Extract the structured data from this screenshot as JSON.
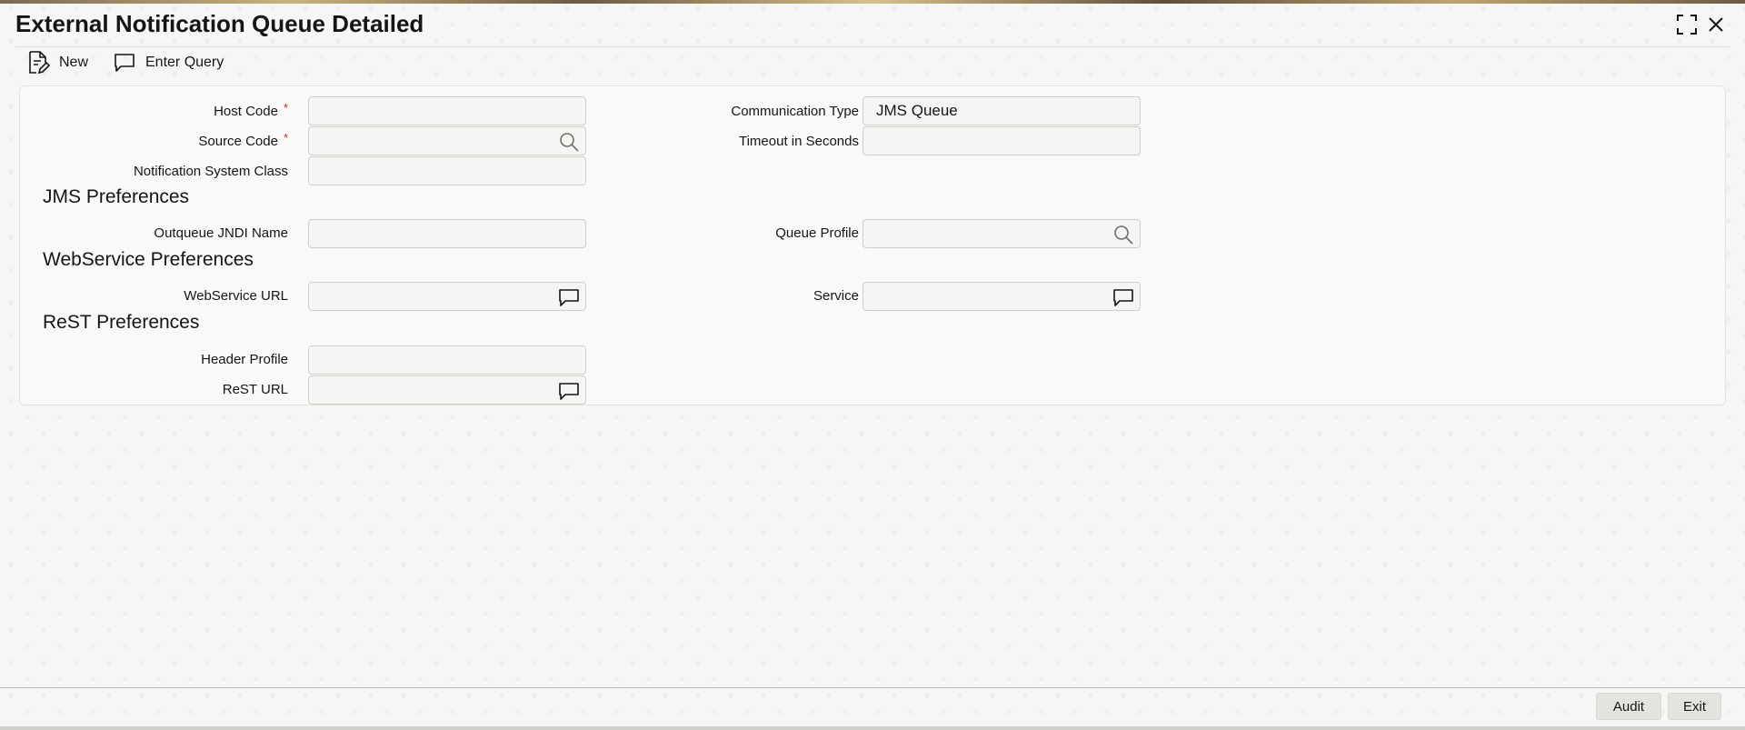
{
  "window": {
    "title": "External Notification Queue Detailed",
    "maximize_icon": "maximize-icon",
    "close_icon": "close-icon"
  },
  "toolbar": {
    "new_label": "New",
    "new_icon": "document-edit-icon",
    "enter_query_label": "Enter Query",
    "enter_query_icon": "chat-bubble-icon"
  },
  "form": {
    "host_code": {
      "label": "Host Code",
      "required": "*",
      "value": ""
    },
    "source_code": {
      "label": "Source Code",
      "required": "*",
      "value": "",
      "icon": "search-icon"
    },
    "notification_system_class": {
      "label": "Notification System Class",
      "value": ""
    },
    "communication_type": {
      "label": "Communication Type",
      "value": "JMS Queue"
    },
    "timeout_in_seconds": {
      "label": "Timeout in Seconds",
      "value": ""
    }
  },
  "jms_preferences": {
    "heading": "JMS Preferences",
    "outqueue_jndi_name": {
      "label": "Outqueue JNDI Name",
      "value": ""
    },
    "queue_profile": {
      "label": "Queue Profile",
      "value": "",
      "icon": "search-icon"
    }
  },
  "webservice_preferences": {
    "heading": "WebService Preferences",
    "webservice_url": {
      "label": "WebService URL",
      "value": "",
      "icon": "chat-bubble-icon"
    },
    "service": {
      "label": "Service",
      "value": "",
      "icon": "chat-bubble-icon"
    }
  },
  "rest_preferences": {
    "heading": "ReST Preferences",
    "header_profile": {
      "label": "Header Profile",
      "value": ""
    },
    "rest_url": {
      "label": "ReST URL",
      "value": "",
      "icon": "chat-bubble-icon"
    }
  },
  "footer": {
    "audit_label": "Audit",
    "exit_label": "Exit"
  },
  "colors": {
    "required_marker": "#c3321d",
    "field_border": "#cfceca",
    "panel_background": "#f9f9f8"
  }
}
